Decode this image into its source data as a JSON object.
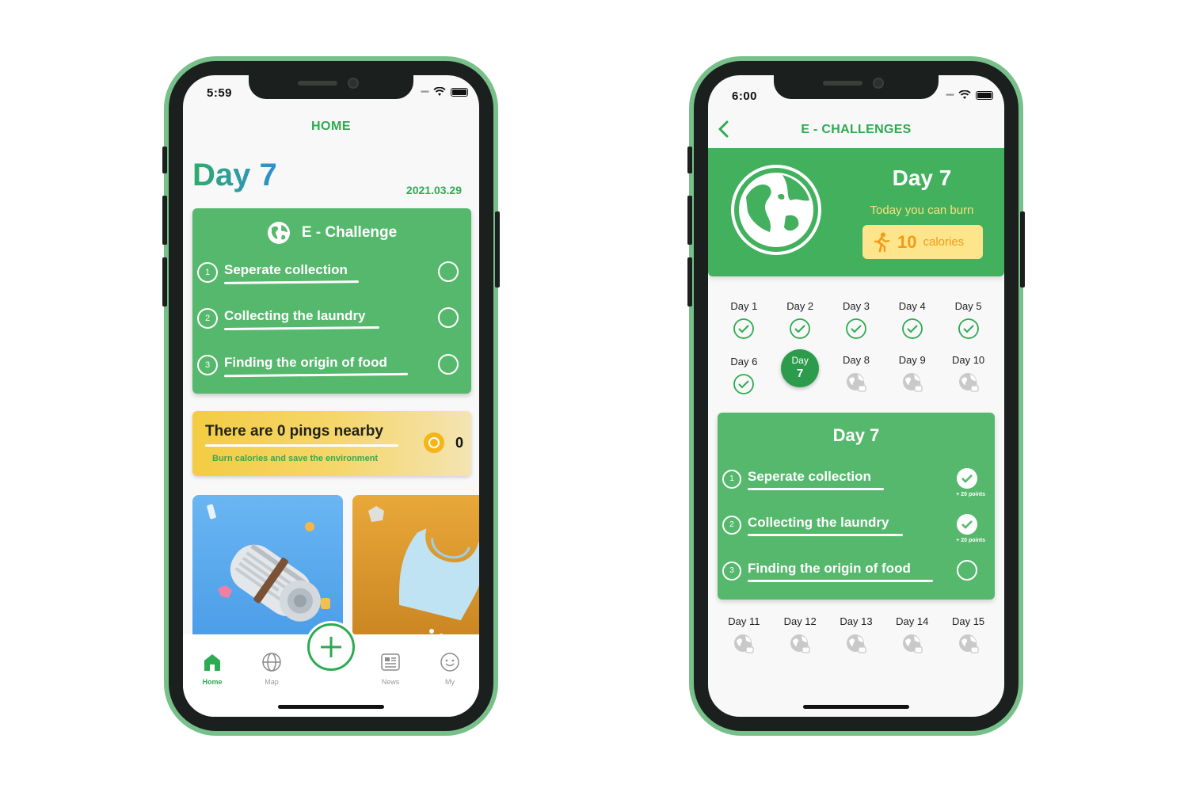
{
  "left": {
    "status": {
      "time": "5:59"
    },
    "header": {
      "title": "HOME"
    },
    "day": {
      "label": "Day 7",
      "date": "2021.03.29"
    },
    "challenge": {
      "title": "E - Challenge",
      "tasks": [
        {
          "num": "1",
          "label": "Seperate collection"
        },
        {
          "num": "2",
          "label": "Collecting the laundry"
        },
        {
          "num": "3",
          "label": "Finding the origin of food"
        }
      ]
    },
    "pings": {
      "title": "There are 0 pings nearby",
      "subtitle": "Burn calories and save the environment",
      "count": "0"
    },
    "tabs": [
      {
        "label": "Home",
        "icon": "home-icon"
      },
      {
        "label": "Map",
        "icon": "globe-icon"
      },
      {
        "label": "News",
        "icon": "news-icon"
      },
      {
        "label": "My",
        "icon": "smile-icon"
      }
    ]
  },
  "right": {
    "status": {
      "time": "6:00"
    },
    "header": {
      "title": "E - CHALLENGES"
    },
    "hero": {
      "day": "Day 7",
      "subtitle": "Today you can burn",
      "calories_value": "10",
      "calories_unit": "calories"
    },
    "days_row1": [
      "Day 1",
      "Day 2",
      "Day 3",
      "Day 4",
      "Day 5"
    ],
    "days_row2": [
      "Day 6",
      "Day 8",
      "Day 9",
      "Day 10"
    ],
    "current_day": {
      "top": "Day",
      "num": "7"
    },
    "days_row3": [
      "Day 11",
      "Day 12",
      "Day 13",
      "Day 14",
      "Day 15"
    ],
    "day_card": {
      "title": "Day 7",
      "tasks": [
        {
          "num": "1",
          "label": "Seperate collection",
          "points": "+ 20 points",
          "done": true
        },
        {
          "num": "2",
          "label": "Collecting the laundry",
          "points": "+ 20 points",
          "done": true
        },
        {
          "num": "3",
          "label": "Finding the origin of food",
          "done": false
        }
      ]
    }
  },
  "colors": {
    "brand_green": "#2eaa52",
    "card_green": "#56b86d",
    "hero_green": "#42b05d",
    "frame_green": "#77c08a",
    "calorie_orange": "#f39b18"
  }
}
